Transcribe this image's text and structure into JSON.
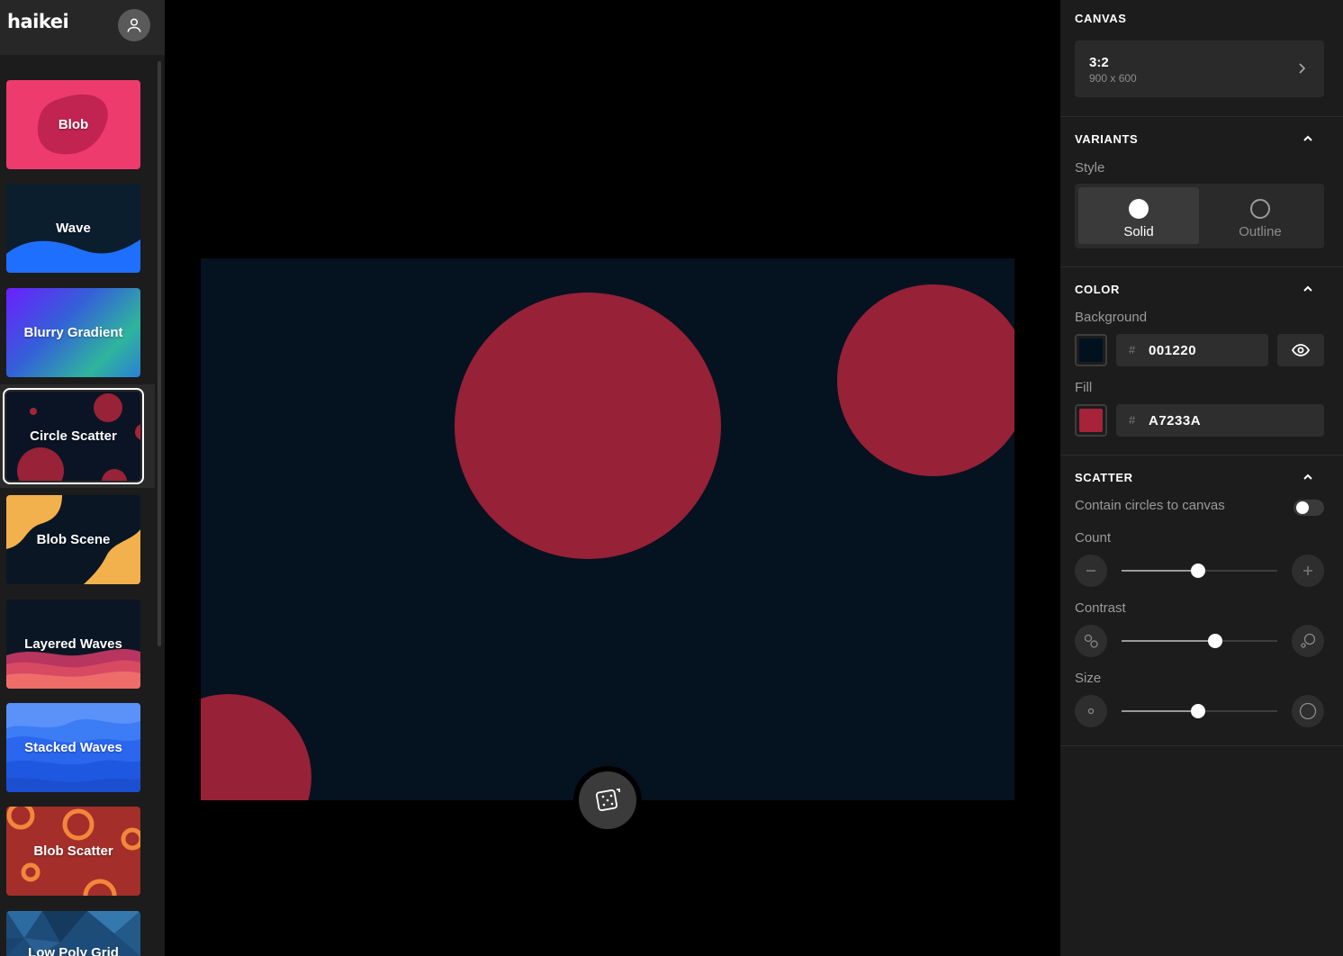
{
  "app": {
    "logo": "haikei"
  },
  "sidebar": {
    "tiles": [
      {
        "label": "Blob"
      },
      {
        "label": "Wave"
      },
      {
        "label": "Blurry Gradient"
      },
      {
        "label": "Circle Scatter",
        "selected": true
      },
      {
        "label": "Blob Scene"
      },
      {
        "label": "Layered Waves"
      },
      {
        "label": "Stacked Waves"
      },
      {
        "label": "Blob Scatter"
      },
      {
        "label": "Low Poly Grid"
      }
    ]
  },
  "canvas_preview": {
    "background": "#001220",
    "fill": "#A7233A"
  },
  "panel": {
    "canvas": {
      "title": "CANVAS",
      "ratio": "3:2",
      "size": "900 x 600"
    },
    "variants": {
      "title": "VARIANTS",
      "style_label": "Style",
      "options": [
        "Solid",
        "Outline"
      ],
      "selected": "Solid"
    },
    "color": {
      "title": "COLOR",
      "background_label": "Background",
      "background_hex": "001220",
      "fill_label": "Fill",
      "fill_hex": "A7233A",
      "hash": "#"
    },
    "scatter": {
      "title": "SCATTER",
      "contain_label": "Contain circles to canvas",
      "contain_on": false,
      "count_label": "Count",
      "count": 0.49,
      "contrast_label": "Contrast",
      "contrast": 0.6,
      "size_label": "Size",
      "size": 0.49
    }
  },
  "colors": {
    "panel_bg": "#1c1c1c",
    "accent_white": "#ffffff",
    "fill": "#A7233A",
    "bg": "#001220"
  }
}
